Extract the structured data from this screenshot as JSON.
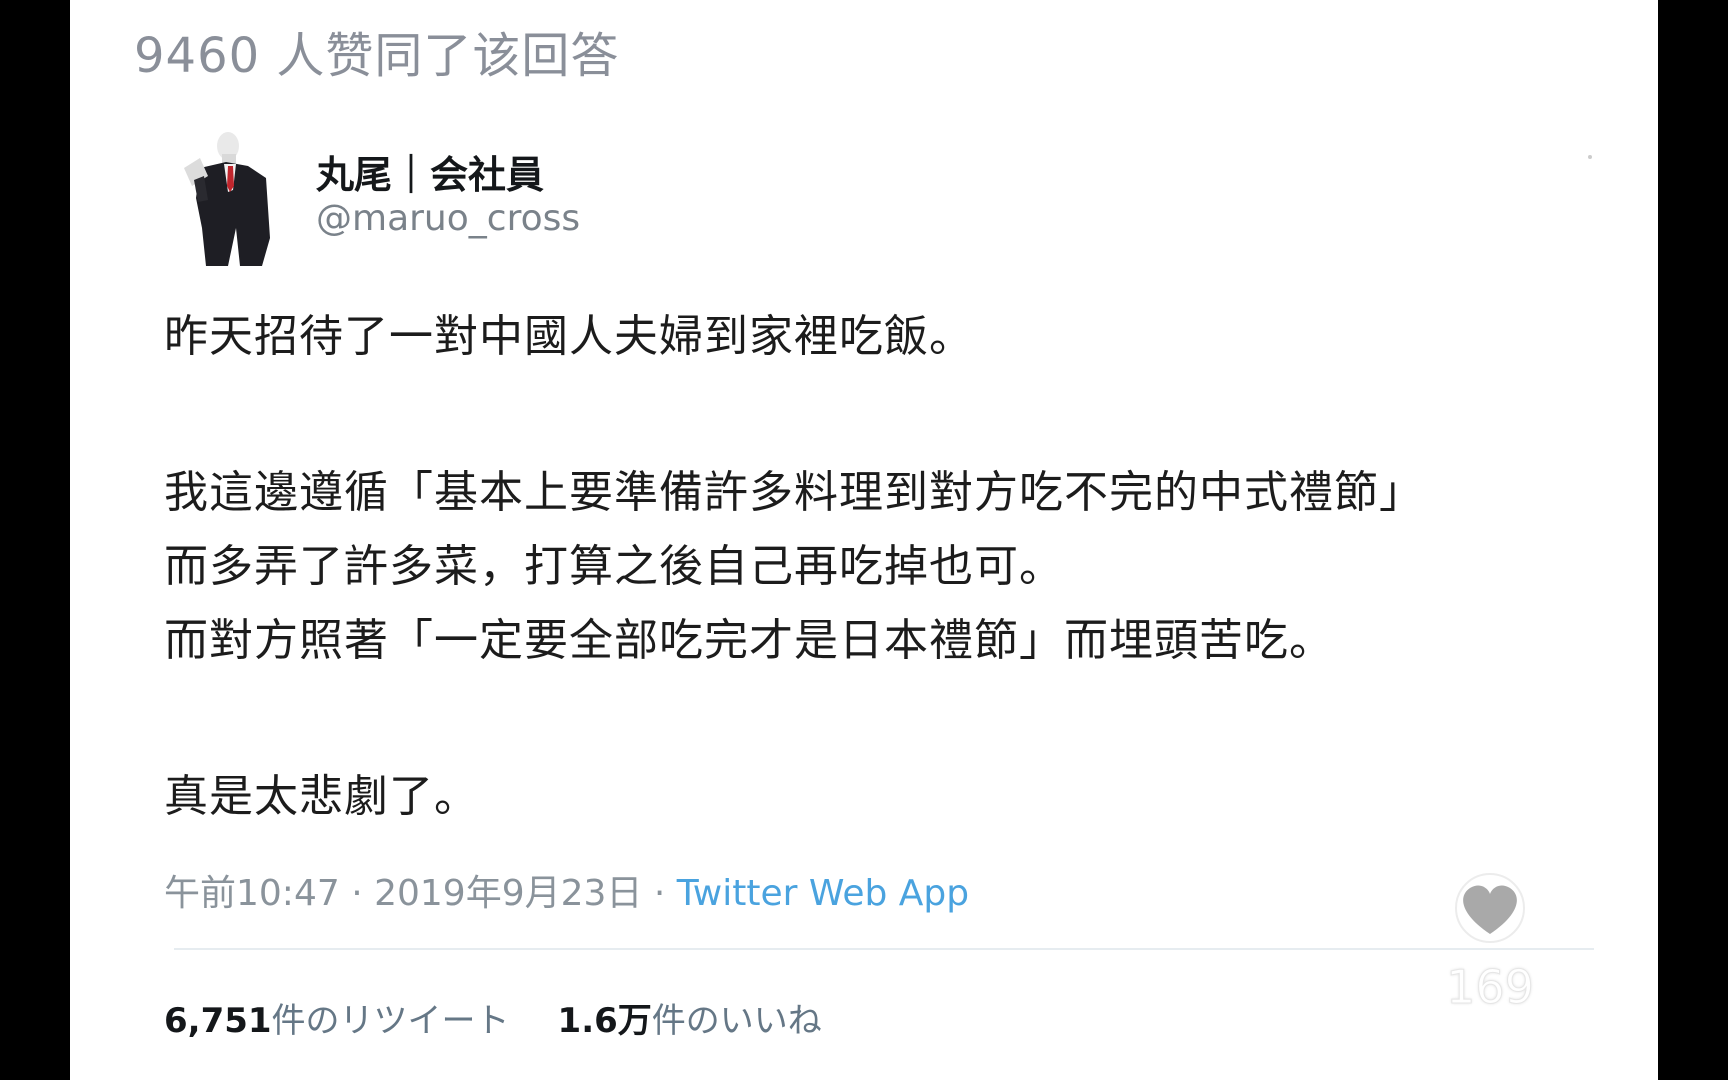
{
  "answer_header": {
    "upvote_text": "9460 人赞同了该回答"
  },
  "tweet": {
    "author": {
      "display_name": "丸尾｜会社員",
      "handle": "@maruo_cross"
    },
    "body_lines": [
      "昨天招待了一對中國人夫婦到家裡吃飯。",
      "我這邊遵循「基本上要準備許多料理到對方吃不完的中式禮節」",
      "而多弄了許多菜，打算之後自己再吃掉也可。",
      "而對方照著「一定要全部吃完才是日本禮節」而埋頭苦吃。",
      "真是太悲劇了。"
    ],
    "timestamp": "午前10:47 · 2019年9月23日 · ",
    "source": "Twitter Web App",
    "retweets_count": "6,751",
    "retweets_suffix": "件のリツイート",
    "likes_count": "1.6万",
    "likes_suffix": "件のいいね"
  },
  "overlay": {
    "like_icon": "heart-icon",
    "like_count": "169"
  },
  "colors": {
    "background": "#000000",
    "card": "#ffffff",
    "link": "#4aa3df",
    "muted": "#8a939b"
  }
}
